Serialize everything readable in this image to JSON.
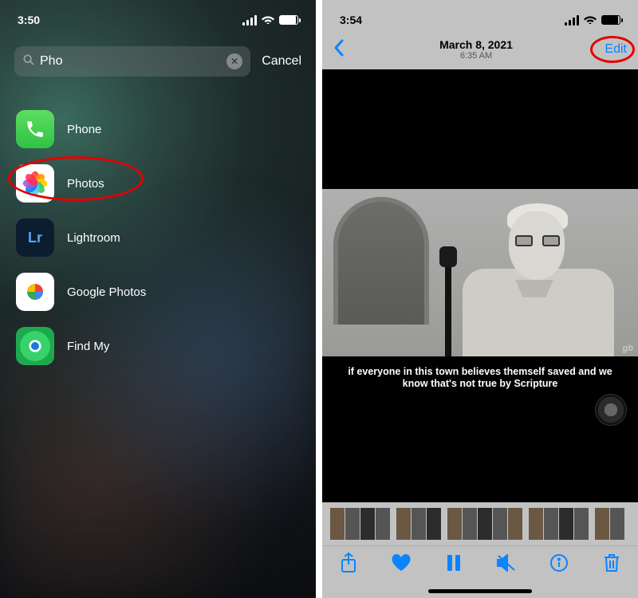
{
  "left": {
    "status_time": "3:50",
    "search": {
      "query": "Pho",
      "cancel": "Cancel"
    },
    "results": [
      {
        "name": "Phone"
      },
      {
        "name": "Photos"
      },
      {
        "name": "Lightroom"
      },
      {
        "name": "Google Photos"
      },
      {
        "name": "Find My"
      }
    ],
    "lr_glyph": "Lr"
  },
  "right": {
    "status_time": "3:54",
    "nav": {
      "date": "March 8, 2021",
      "time": "6:35 AM",
      "edit": "Edit"
    },
    "caption": "if everyone in this town believes themself saved and we know that's not true by Scripture",
    "watermark": "gb",
    "toolbar": {
      "share": "share-icon",
      "favorite": "heart-icon",
      "pause": "pause-icon",
      "mute": "mute-icon",
      "info": "info-icon",
      "trash": "trash-icon"
    }
  }
}
